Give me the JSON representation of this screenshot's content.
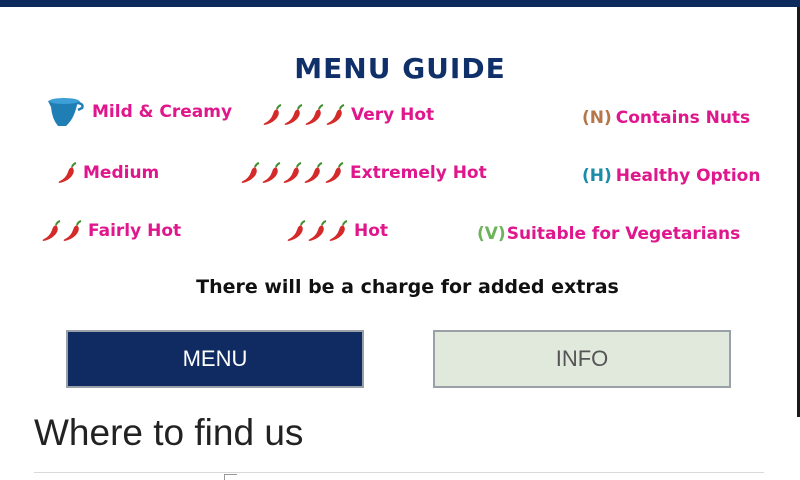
{
  "guide": {
    "title": "MENU GUIDE",
    "legend": {
      "mild": {
        "label": "Mild & Creamy",
        "icon": "jug-icon"
      },
      "very_hot": {
        "label": "Very Hot",
        "chilis": 4
      },
      "nuts": {
        "code": "(N)",
        "label": "Contains Nuts",
        "code_color": "#b5764a"
      },
      "medium": {
        "label": "Medium",
        "chilis": 1
      },
      "extremely_hot": {
        "label": "Extremely Hot",
        "chilis": 5
      },
      "healthy": {
        "code": "(H)",
        "label": "Healthy Option",
        "code_color": "#1b8ca8"
      },
      "fairly_hot": {
        "label": "Fairly Hot",
        "chilis": 2
      },
      "hot": {
        "label": "Hot",
        "chilis": 3
      },
      "vegetarian": {
        "code": "(V)",
        "label": "Suitable for Vegetarians",
        "code_color": "#6cb35a"
      }
    },
    "charge_note": "There will be a charge for added extras"
  },
  "buttons": {
    "menu": "MENU",
    "info": "INFO"
  },
  "section": {
    "find_us": "Where to find us"
  },
  "colors": {
    "brand_navy": "#0f2b62",
    "legend_pink": "#e0168c",
    "chili_red": "#d42a2a",
    "jug_blue": "#1f7fb5",
    "info_bg": "#e0e9dc"
  }
}
